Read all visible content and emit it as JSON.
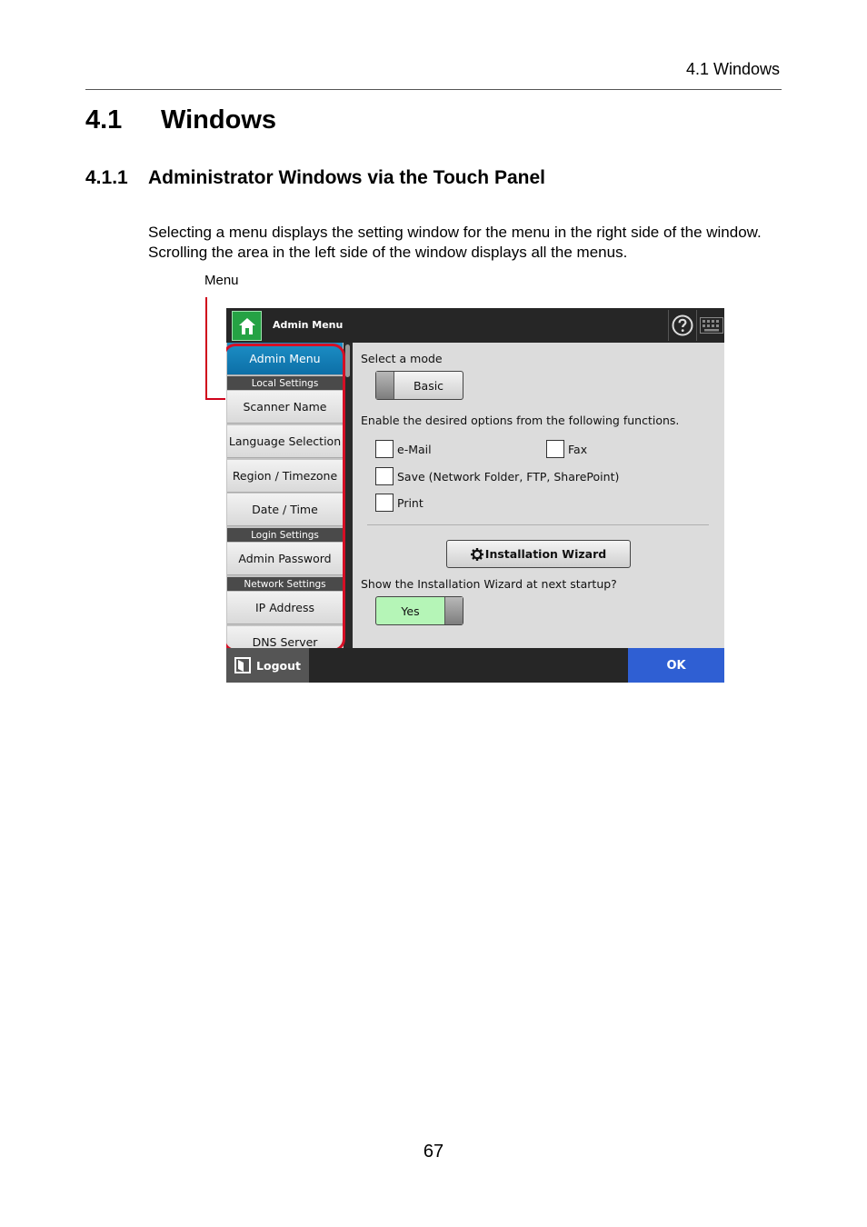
{
  "running_header": "4.1 Windows",
  "section": {
    "number": "4.1",
    "title": "Windows"
  },
  "subsection": {
    "number": "4.1.1",
    "title": "Administrator Windows via the Touch Panel"
  },
  "paragraph": {
    "line1": "Selecting a menu displays the setting window for the menu in the right side of the window.",
    "line2": "Scrolling the area in the left side of the window displays all the menus."
  },
  "callout_label": "Menu",
  "screen": {
    "topbar_title": "Admin Menu",
    "sidebar": {
      "active": "Admin Menu",
      "local_settings": "Local Settings",
      "scanner_name": "Scanner Name",
      "language_selection": "Language Selection",
      "region_timezone": "Region / Timezone",
      "date_time": "Date / Time",
      "login_settings": "Login Settings",
      "admin_password": "Admin Password",
      "network_settings": "Network Settings",
      "ip_address": "IP Address",
      "dns_server": "DNS Server"
    },
    "content": {
      "mode_label": "Select a mode",
      "mode_value": "Basic",
      "enable_label": "Enable the desired options from the following functions.",
      "opt_email": "e-Mail",
      "opt_fax": "Fax",
      "opt_save": "Save (Network Folder, FTP, SharePoint)",
      "opt_print": "Print",
      "wizard_button": "Installation Wizard",
      "wizard_question": "Show the Installation Wizard at next startup?",
      "wizard_value": "Yes"
    },
    "logout_label": "Logout",
    "ok_label": "OK"
  },
  "page_number": "67",
  "colors": {
    "callout_red": "#d50f25",
    "active_blue": "#0d6fa7",
    "ok_blue": "#2f5fd3",
    "yes_green": "#b5f5b7",
    "home_green": "#25a244"
  }
}
